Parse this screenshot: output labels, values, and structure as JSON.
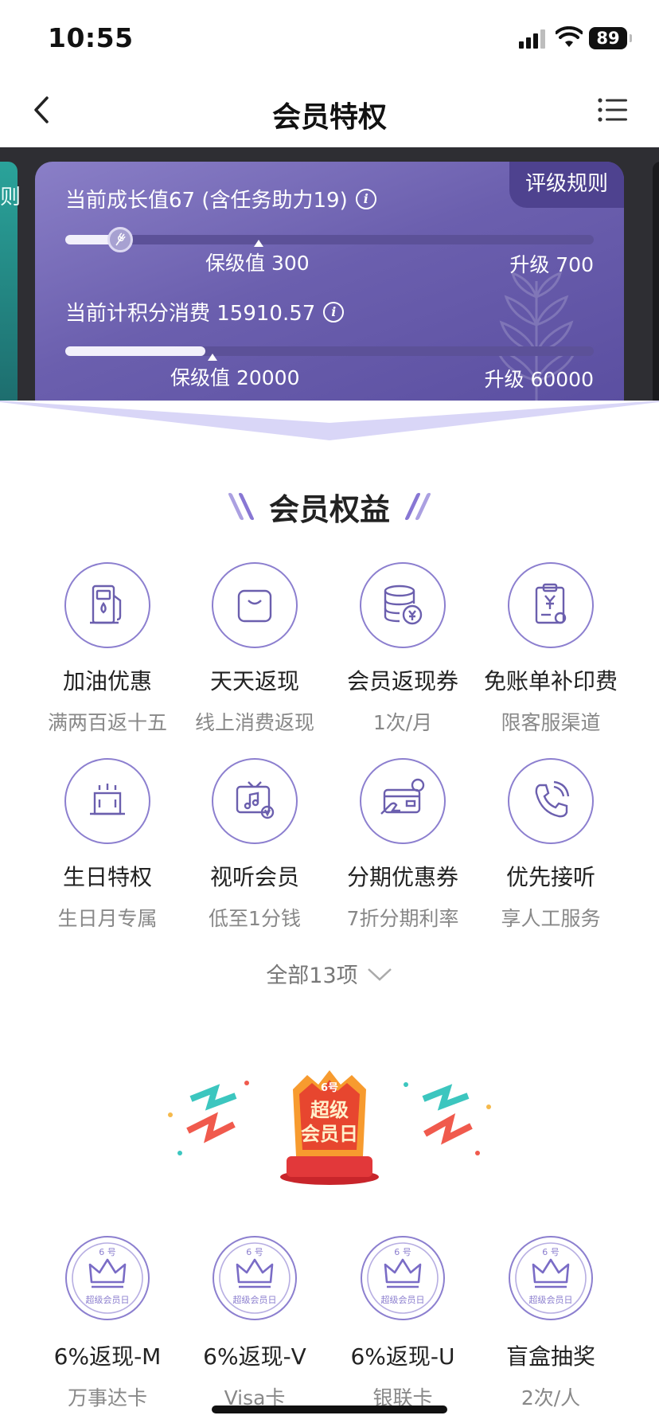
{
  "status_bar": {
    "time": "10:55",
    "battery": "89"
  },
  "nav": {
    "title": "会员特权"
  },
  "banner": {
    "left_card_text": "则",
    "rules_label": "评级规则",
    "growth": {
      "label": "当前成长值67 (含任务助力19)",
      "progress": 0.08,
      "keep_label": "保级值 300",
      "upgrade_label": "升级 700"
    },
    "points": {
      "label": "当前计积分消费 15910.57",
      "progress": 0.265,
      "keep_label": "保级值 20000",
      "upgrade_label": "升级 60000"
    }
  },
  "benefits": {
    "title": "会员权益",
    "items": [
      {
        "icon": "fuel-pump-icon",
        "name": "加油优惠",
        "sub": "满两百返十五"
      },
      {
        "icon": "shopping-bag-icon",
        "name": "天天返现",
        "sub": "线上消费返现"
      },
      {
        "icon": "coin-stack-icon",
        "name": "会员返现券",
        "sub": "1次/月"
      },
      {
        "icon": "receipt-clipboard-icon",
        "name": "免账单补印费",
        "sub": "限客服渠道"
      },
      {
        "icon": "birthday-cake-icon",
        "name": "生日特权",
        "sub": "生日月专属"
      },
      {
        "icon": "tv-music-icon",
        "name": "视听会员",
        "sub": "低至1分钱"
      },
      {
        "icon": "card-in-hand-icon",
        "name": "分期优惠券",
        "sub": "7折分期利率"
      },
      {
        "icon": "phone-call-icon",
        "name": "优先接听",
        "sub": "享人工服务"
      }
    ],
    "all_label": "全部13项"
  },
  "promo": {
    "badge_top": "6号",
    "badge_line1": "超级",
    "badge_line2": "会员日"
  },
  "member_day": {
    "items": [
      {
        "icon": "crown-badge-icon",
        "name": "6%返现-M",
        "sub": "万事达卡"
      },
      {
        "icon": "crown-badge-icon",
        "name": "6%返现-V",
        "sub": "Visa卡"
      },
      {
        "icon": "crown-badge-icon",
        "name": "6%返现-U",
        "sub": "银联卡"
      },
      {
        "icon": "crown-badge-icon",
        "name": "盲盒抽奖",
        "sub": "2次/人"
      }
    ],
    "badge_top": "6 号",
    "badge_bottom": "超级会员日"
  },
  "colors": {
    "accent": "#8c7fcf",
    "card": "#6b5fae",
    "banner_bg": "#2e2e33"
  }
}
